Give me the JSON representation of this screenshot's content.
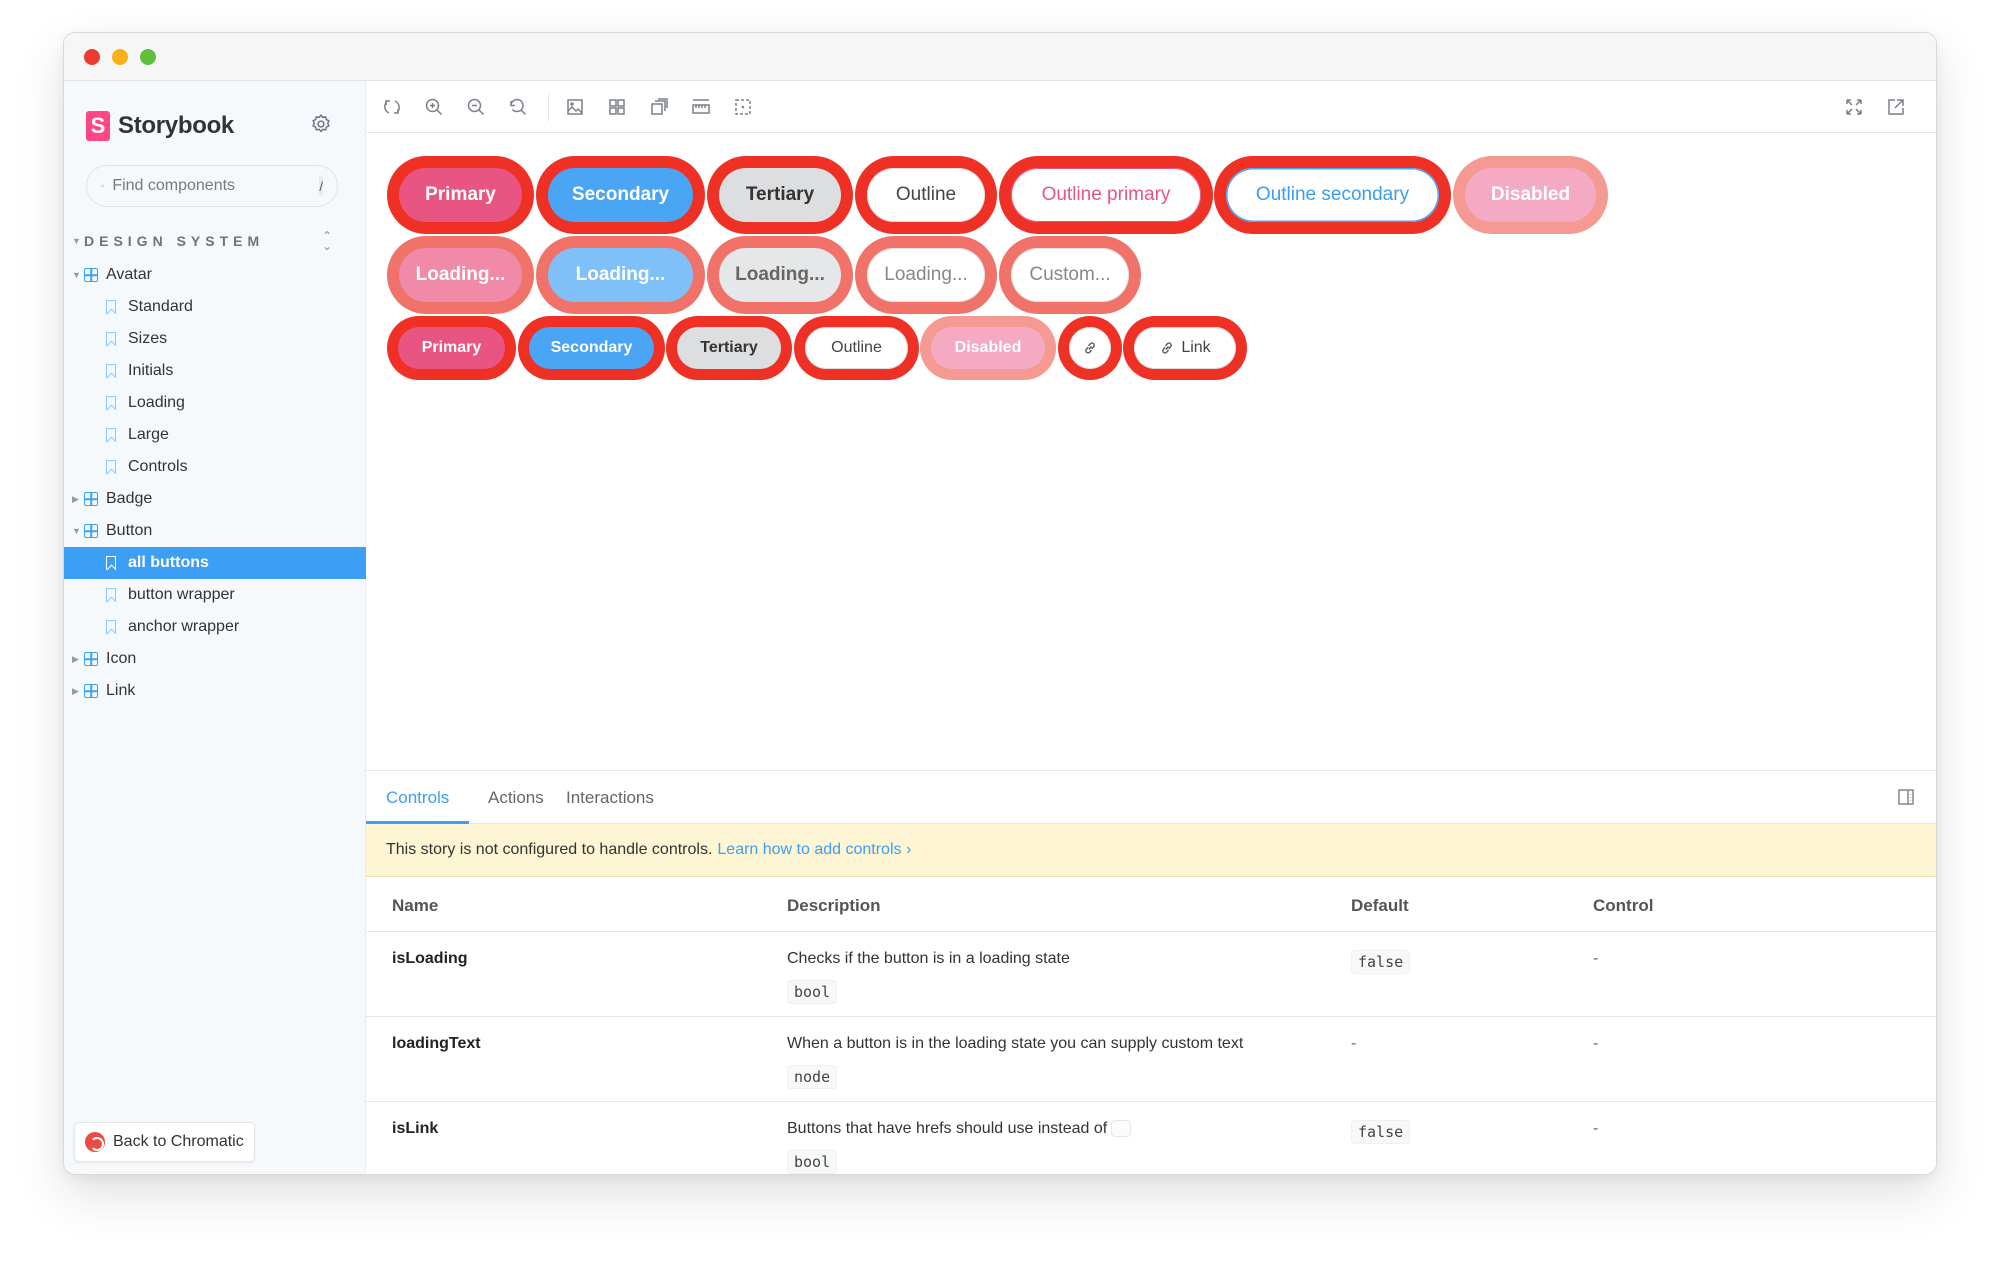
{
  "app": {
    "name": "Storybook"
  },
  "sidebar": {
    "search": {
      "placeholder": "Find components",
      "shortcut": "/"
    },
    "section": "DESIGN SYSTEM",
    "tree": [
      {
        "label": "Avatar",
        "type": "component",
        "level": 1,
        "expanded": true
      },
      {
        "label": "Standard",
        "type": "story",
        "level": 2
      },
      {
        "label": "Sizes",
        "type": "story",
        "level": 2
      },
      {
        "label": "Initials",
        "type": "story",
        "level": 2
      },
      {
        "label": "Loading",
        "type": "story",
        "level": 2
      },
      {
        "label": "Large",
        "type": "story",
        "level": 2
      },
      {
        "label": "Controls",
        "type": "story",
        "level": 2
      },
      {
        "label": "Badge",
        "type": "component",
        "level": 1,
        "expanded": false
      },
      {
        "label": "Button",
        "type": "component",
        "level": 1,
        "expanded": true
      },
      {
        "label": "all buttons",
        "type": "story",
        "level": 2,
        "active": true
      },
      {
        "label": "button wrapper",
        "type": "story",
        "level": 2
      },
      {
        "label": "anchor wrapper",
        "type": "story",
        "level": 2
      },
      {
        "label": "Icon",
        "type": "component",
        "level": 1,
        "expanded": false
      },
      {
        "label": "Link",
        "type": "component",
        "level": 1,
        "expanded": false
      }
    ],
    "back_button": "Back to Chromatic"
  },
  "toolbar": {
    "left_icons": [
      "remount-icon",
      "zoom-in-icon",
      "zoom-out-icon",
      "zoom-reset-icon",
      "background-icon",
      "grid-icon",
      "viewport-icon",
      "measure-icon",
      "outline-icon"
    ],
    "right_icons": [
      "fullscreen-icon",
      "open-new-tab-icon"
    ]
  },
  "canvas": {
    "row1": [
      "Primary",
      "Secondary",
      "Tertiary",
      "Outline",
      "Outline primary",
      "Outline secondary",
      "Disabled"
    ],
    "row2": [
      "Loading...",
      "Loading...",
      "Loading...",
      "Loading...",
      "Custom..."
    ],
    "row3": [
      "Primary",
      "Secondary",
      "Tertiary",
      "Outline",
      "Disabled",
      "",
      "Link"
    ]
  },
  "panel": {
    "tabs": [
      "Controls",
      "Actions",
      "Interactions"
    ],
    "active_tab": "Controls",
    "notice": {
      "text": "This story is not configured to handle controls.",
      "link": "Learn how to add controls ›"
    },
    "table": {
      "headers": [
        "Name",
        "Description",
        "Default",
        "Control"
      ],
      "rows": [
        {
          "name": "isLoading",
          "description": "Checks if the button is in a loading state",
          "type": "bool",
          "default": "false",
          "control": "-"
        },
        {
          "name": "loadingText",
          "description": "When a button is in the loading state you can supply custom text",
          "type": "node",
          "default": "-",
          "control": "-"
        },
        {
          "name": "isLink",
          "description": "Buttons that have hrefs should use instead of",
          "type": "bool",
          "default": "false",
          "control": "-"
        }
      ]
    }
  },
  "colors": {
    "accent": "#3d9ef5",
    "primary": "#e95583",
    "secondary": "#4aa5f5",
    "outline_ring": "#ee3124",
    "notice_bg": "#fdf5d3"
  }
}
